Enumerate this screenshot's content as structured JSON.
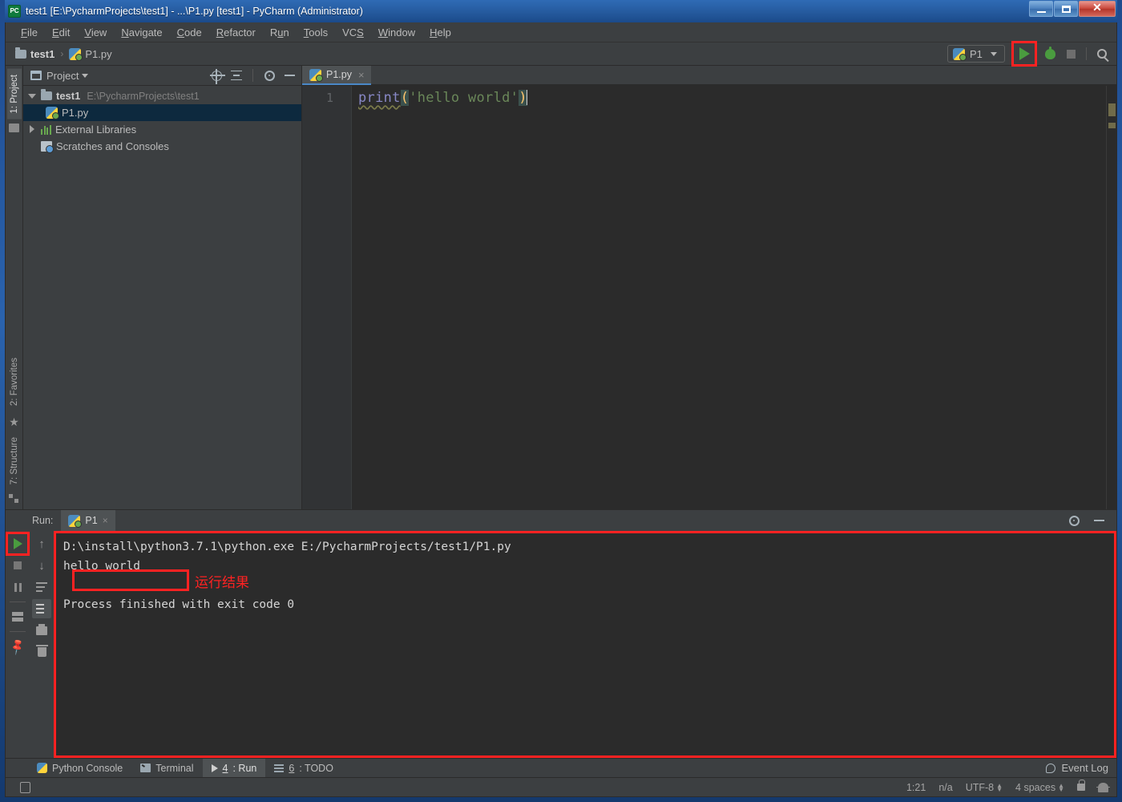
{
  "window": {
    "title": "test1 [E:\\PycharmProjects\\test1] - ...\\P1.py [test1] - PyCharm (Administrator)",
    "app_icon": "PC",
    "buttons": {
      "minimize": "minimize-icon",
      "maximize": "maximize-icon",
      "close": "close-icon"
    }
  },
  "menubar": [
    {
      "pre": "",
      "mn": "F",
      "post": "ile"
    },
    {
      "pre": "",
      "mn": "E",
      "post": "dit"
    },
    {
      "pre": "",
      "mn": "V",
      "post": "iew"
    },
    {
      "pre": "",
      "mn": "N",
      "post": "avigate"
    },
    {
      "pre": "",
      "mn": "C",
      "post": "ode"
    },
    {
      "pre": "",
      "mn": "R",
      "post": "efactor"
    },
    {
      "pre": "R",
      "mn": "u",
      "post": "n"
    },
    {
      "pre": "",
      "mn": "T",
      "post": "ools"
    },
    {
      "pre": "VC",
      "mn": "S",
      "post": ""
    },
    {
      "pre": "",
      "mn": "W",
      "post": "indow"
    },
    {
      "pre": "",
      "mn": "H",
      "post": "elp"
    }
  ],
  "navbar": {
    "crumbs": [
      {
        "label": "test1",
        "icon": "folder-icon"
      },
      {
        "label": "P1.py",
        "icon": "python-file-icon"
      }
    ],
    "separator": "›",
    "run_config": {
      "label": "P1",
      "icon": "python-icon"
    },
    "actions": {
      "run": "run-icon",
      "debug": "debug-icon",
      "stop": "stop-icon",
      "search": "search-icon"
    }
  },
  "left_tool_tabs": [
    {
      "label": "1: Project",
      "icon": "folder-icon",
      "active": true
    },
    {
      "label": "2: Favorites",
      "icon": "star-icon",
      "active": false
    },
    {
      "label": "7: Structure",
      "icon": "structure-icon",
      "active": false
    }
  ],
  "project_panel": {
    "title": "Project",
    "caret": "▾",
    "actions": [
      "target-icon",
      "collapse-all-icon",
      "gear-icon",
      "minimize-icon"
    ],
    "tree": [
      {
        "label": "test1",
        "path": "E:\\PycharmProjects\\test1",
        "icon": "folder-icon",
        "twisty": "down",
        "indent": 0,
        "selected": false,
        "bold": true
      },
      {
        "label": "P1.py",
        "path": "",
        "icon": "python-file-icon",
        "twisty": "none",
        "indent": 1,
        "selected": true,
        "bold": false
      },
      {
        "label": "External Libraries",
        "path": "",
        "icon": "library-icon",
        "twisty": "right",
        "indent": 0,
        "selected": false,
        "bold": false
      },
      {
        "label": "Scratches and Consoles",
        "path": "",
        "icon": "scratches-icon",
        "twisty": "none",
        "indent": 0,
        "selected": false,
        "bold": false
      }
    ]
  },
  "editor": {
    "tabs": [
      {
        "label": "P1.py",
        "icon": "python-file-icon",
        "close": "×",
        "active": true
      }
    ],
    "line_number": "1",
    "code": {
      "fn": "print",
      "open_paren": "(",
      "string": "'hello world'",
      "close_paren": ")"
    }
  },
  "run_window": {
    "label": "Run:",
    "tab": {
      "label": "P1",
      "icon": "python-icon",
      "close": "×"
    },
    "header_actions": [
      "gear-icon",
      "minimize-icon"
    ],
    "left_toolbar": [
      "rerun-icon",
      "stop-icon",
      "pause-icon",
      "layout-icon",
      "pin-icon"
    ],
    "right_toolbar": [
      "up-arrow-icon",
      "down-arrow-icon",
      "soft-wrap-icon",
      "scroll-to-end-icon",
      "print-icon",
      "trash-icon"
    ],
    "console_lines": [
      "D:\\install\\python3.7.1\\python.exe E:/PycharmProjects/test1/P1.py",
      "hello world",
      "",
      "Process finished with exit code 0"
    ],
    "annotation": "运行结果"
  },
  "bottom_bar": {
    "tabs": [
      {
        "pre": "Python Console",
        "mn": "",
        "post": "",
        "icon": "python-console-icon",
        "active": false
      },
      {
        "pre": "Terminal",
        "mn": "",
        "post": "",
        "icon": "terminal-icon",
        "active": false
      },
      {
        "pre": "",
        "mn": "4",
        "post": ": Run",
        "icon": "run-icon",
        "active": true
      },
      {
        "pre": "",
        "mn": "6",
        "post": ": TODO",
        "icon": "todo-icon",
        "active": false
      }
    ],
    "event_log": {
      "label": "Event Log",
      "icon": "event-log-icon"
    }
  },
  "statusbar": {
    "left_icon": "toggle-toolbar-icon",
    "caret_position": "1:21",
    "line_separator": "n/a",
    "encoding": "UTF-8",
    "indent": "4 spaces",
    "lock": "lock-icon",
    "inspections": "hector-icon"
  },
  "colors": {
    "accent_blue": "#4a88c7",
    "annotation_red": "#ff2222",
    "run_green": "#4a9c3f",
    "selection": "#0d293e",
    "editor_bg": "#2b2b2b",
    "panel_bg": "#3c3f41"
  }
}
